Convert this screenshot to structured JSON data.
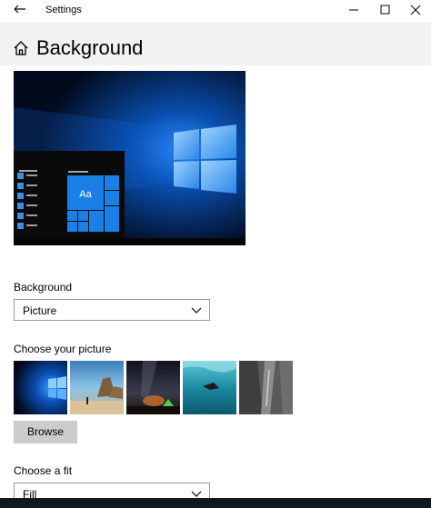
{
  "window": {
    "title": "Settings"
  },
  "header": {
    "title": "Background"
  },
  "preview": {
    "tile_text": "Aa"
  },
  "background": {
    "label": "Background",
    "value": "Picture"
  },
  "picture": {
    "label": "Choose your picture",
    "thumbnails": [
      "windows-hero",
      "beach-rocks",
      "night-sky-tent",
      "underwater-swimmer",
      "rock-cliff"
    ],
    "browse_label": "Browse"
  },
  "fit": {
    "label": "Choose a fit",
    "value": "Fill"
  },
  "colors": {
    "accent": "#0078d7",
    "header_bg": "#f2f2f2",
    "button_bg": "#cccccc"
  }
}
